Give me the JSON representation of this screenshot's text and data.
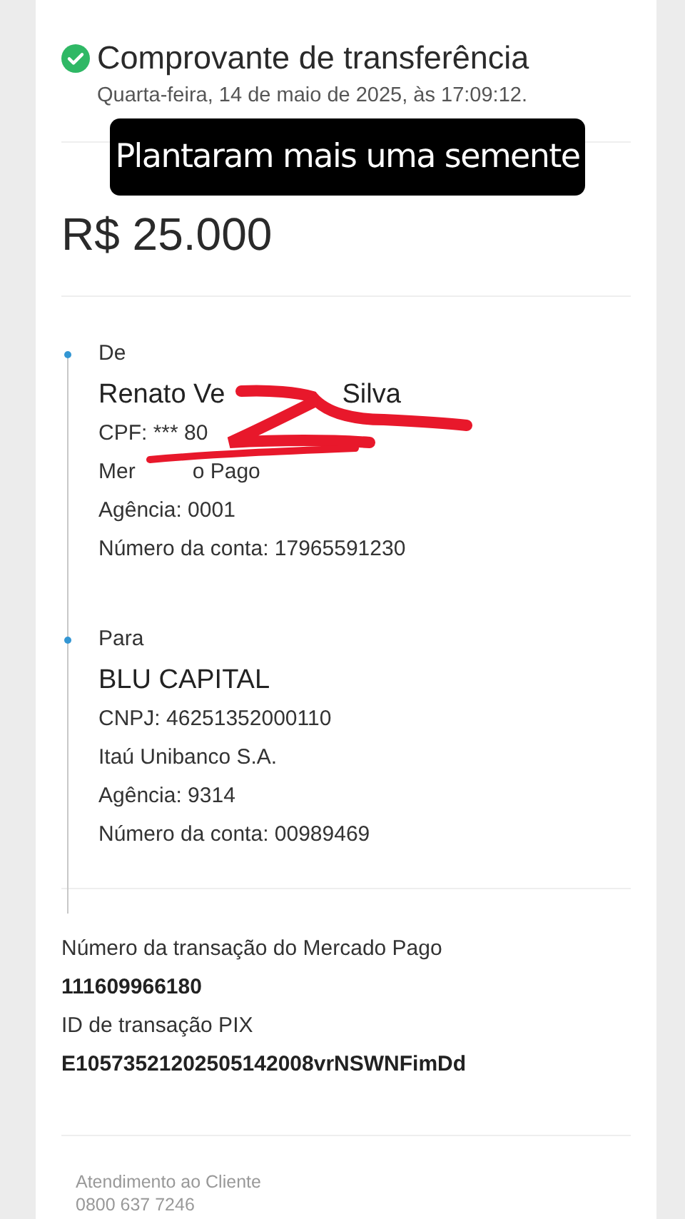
{
  "header": {
    "title": "Comprovante de transferência",
    "date": "Quarta-feira, 14 de maio de 2025, às 17:09:12."
  },
  "caption": "Plantaram mais uma semente",
  "amount": "R$ 25.000",
  "parties": [
    {
      "label": "De",
      "name_parts": [
        "Renato Ve",
        "Silva"
      ],
      "lines": [
        [
          "CPF: *** 80"
        ],
        [
          "Mer",
          "o Pago"
        ],
        [
          "Agência: 0001"
        ],
        [
          "Número da conta: 17965591230"
        ]
      ],
      "redacted": true
    },
    {
      "label": "Para",
      "name_parts": [
        "BLU CAPITAL"
      ],
      "lines": [
        [
          "CNPJ: 46251352000110"
        ],
        [
          "Itaú Unibanco S.A."
        ],
        [
          "Agência: 9314"
        ],
        [
          "Número da conta: 00989469"
        ]
      ],
      "redacted": false
    }
  ],
  "transaction": [
    {
      "label": "Número da transação do Mercado Pago",
      "value": "111609966180"
    },
    {
      "label": "ID de transação PIX",
      "value": "E10573521202505142008vrNSWNFimDd"
    }
  ],
  "footer": {
    "label": "Atendimento ao Cliente",
    "phone": "0800 637 7246"
  }
}
